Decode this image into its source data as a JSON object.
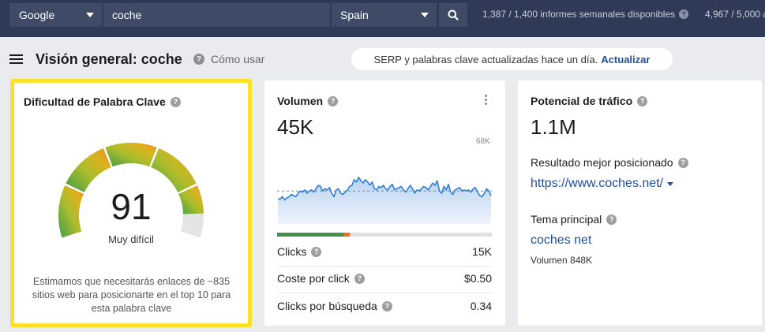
{
  "topbar": {
    "engine": "Google",
    "keyword": "coche",
    "country": "Spain",
    "reports_stat": "1,387 / 1,400 informes semanales disponibles",
    "credits_stat": "4,967 / 5,000 a"
  },
  "header": {
    "title": "Visión general: coche",
    "how_to": "Cómo usar",
    "notice_text": "SERP y palabras clave actualizadas hace un día.",
    "notice_link": "Actualizar"
  },
  "kd_card": {
    "title": "Dificultad de Palabra Clave",
    "score": "91",
    "score_level": 0.91,
    "label": "Muy difícil",
    "description": "Estimamos que necesitarás enlaces de ~835 sitios web para posicionarte en el top 10 para esta palabra clave"
  },
  "volume_card": {
    "title": "Volumen",
    "value": "45K",
    "axis_max": "68K",
    "trend": [
      22,
      22,
      24,
      21,
      23,
      24,
      26,
      25,
      24,
      27,
      29,
      28,
      30,
      27,
      29,
      30,
      28,
      31,
      34,
      33,
      29,
      31,
      30,
      32,
      27,
      24,
      30,
      31,
      27,
      26,
      28,
      30,
      33,
      34,
      39,
      37,
      41,
      38,
      36,
      39,
      37,
      34,
      37,
      31,
      30,
      33,
      32,
      34,
      31,
      30,
      33,
      35,
      30,
      31,
      32,
      33,
      30,
      28,
      31,
      34,
      31,
      27,
      30,
      29,
      31,
      33,
      32,
      30,
      33,
      36,
      34,
      38,
      29,
      27,
      33,
      30,
      35,
      28,
      26,
      30,
      31,
      32,
      29,
      30,
      29,
      30,
      28,
      31,
      32,
      28,
      25,
      24,
      27,
      31,
      29,
      25
    ],
    "avg_line": 29,
    "clicks_split": {
      "organic": 0.31,
      "paid": 0.03
    },
    "metrics": [
      {
        "label": "Clicks",
        "value": "15K"
      },
      {
        "label": "Coste por click",
        "value": "$0.50"
      },
      {
        "label": "Clicks por búsqueda",
        "value": "0.34"
      }
    ]
  },
  "traffic_card": {
    "title": "Potencial de tráfico",
    "value": "1.1M",
    "top_result_label": "Resultado mejor posicionado",
    "top_result_url": "https://www.coches.net/",
    "parent_topic_label": "Tema principal",
    "parent_topic": "coches net",
    "parent_volume": "Volumen 848K"
  },
  "colors": {
    "topbar": "#2f3a56",
    "highlight": "#fde02a",
    "link": "#1f4f9e",
    "chart_line": "#2f7fd6"
  }
}
